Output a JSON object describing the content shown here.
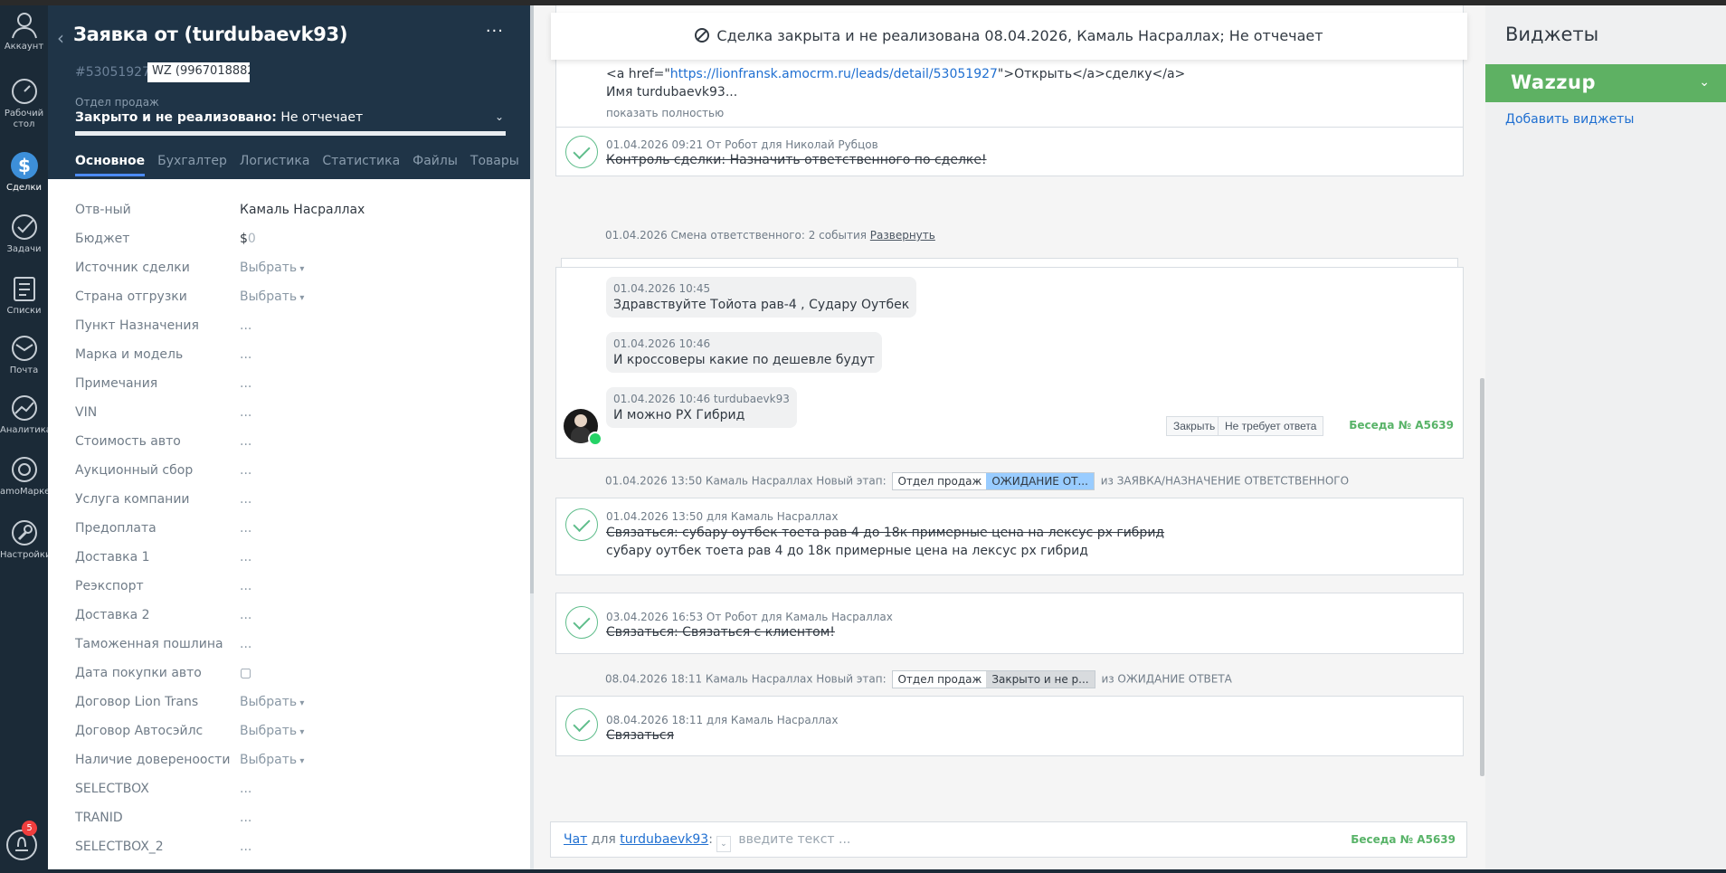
{
  "nav": {
    "items": [
      {
        "label": "Аккаунт",
        "icon": "user-icon"
      },
      {
        "label": "Рабочий стол",
        "icon": "dashboard-icon"
      },
      {
        "label": "Сделки",
        "icon": "dollar-icon"
      },
      {
        "label": "Задачи",
        "icon": "check-icon"
      },
      {
        "label": "Списки",
        "icon": "list-icon"
      },
      {
        "label": "Почта",
        "icon": "mail-icon"
      },
      {
        "label": "Аналитика",
        "icon": "analytics-icon"
      },
      {
        "label": "amoМаркет",
        "icon": "market-icon"
      },
      {
        "label": "Настройки",
        "icon": "wrench-icon"
      }
    ],
    "notifications_count": "5"
  },
  "card": {
    "title": "Заявка от (turdubaevk93)",
    "lead_id": "#53051927",
    "tag": "WZ (9967018882",
    "pipeline": "Отдел продаж",
    "status_bold": "Закрыто и не реализовано:",
    "status_reason": " Не отчечает",
    "tabs": [
      "Основное",
      "Бухгалтер",
      "Логистика",
      "Статистика",
      "Файлы",
      "Товары",
      "···"
    ],
    "fields": [
      {
        "label": "Отв-ный",
        "value": "Камаль Насраллах"
      },
      {
        "label": "Бюджет",
        "value": "$",
        "value2": "0"
      },
      {
        "label": "Источник сделки",
        "value": "Выбрать",
        "select": true
      },
      {
        "label": "Страна отгрузки",
        "value": "Выбрать",
        "select": true
      },
      {
        "label": "Пункт Назначения",
        "value": "..."
      },
      {
        "label": "Марка и модель",
        "value": "..."
      },
      {
        "label": "Примечания",
        "value": "..."
      },
      {
        "label": "VIN",
        "value": "..."
      },
      {
        "label": "Стоимость авто",
        "value": "..."
      },
      {
        "label": "Аукционный сбор",
        "value": "..."
      },
      {
        "label": "Услуга компании",
        "value": "..."
      },
      {
        "label": "Предоплата",
        "value": "..."
      },
      {
        "label": "Доставка 1",
        "value": "..."
      },
      {
        "label": "Реэкспорт",
        "value": "..."
      },
      {
        "label": "Доставка 2",
        "value": "..."
      },
      {
        "label": "Таможенная пошлина",
        "value": "..."
      },
      {
        "label": "Дата покупки авто",
        "value": "▢"
      },
      {
        "label": "Договор Lion Trans",
        "value": "Выбрать",
        "select": true
      },
      {
        "label": "Договор Автосэйлс",
        "value": "Выбрать",
        "select": true
      },
      {
        "label": "Наличие довереноости",
        "value": "Выбрать",
        "select": true
      },
      {
        "label": "SELECTBOX",
        "value": "..."
      },
      {
        "label": "TRANID",
        "value": "..."
      },
      {
        "label": "SELECTBOX_2",
        "value": "..."
      }
    ]
  },
  "feed": {
    "toast": "Сделка закрыта и не реализована 08.04.2026, Камаль Насраллах; Не отчечает",
    "note": {
      "link_prefix": "<a href=\"",
      "link_url": "https://lionfransk.amocrm.ru/leads/detail/53051927",
      "link_suffix": "\">Открыть</a>сделку</a>",
      "name": "Имя turdubaevk93...",
      "more": "показать полностью"
    },
    "task1": {
      "meta": "01.04.2026 09:21  От Робот для Николай Рубцов",
      "text": "Контроль сделки: Назначить ответственного по сделке!"
    },
    "resp_change": {
      "text": "01.04.2026 Смена ответственного: 2 события ",
      "link": "Развернуть"
    },
    "chat": {
      "messages": [
        {
          "time": "01.04.2026 10:45",
          "text": "Здравствуйте Тойота рав-4 , Судару Оутбек"
        },
        {
          "time": "01.04.2026 10:46",
          "text": "И кроссоверы какие по дешевле будут"
        },
        {
          "time": "01.04.2026 10:46 turdubaevk93",
          "text": "И можно РХ Гибрид"
        }
      ],
      "close_btn": "Закрыть",
      "noreply_btn": "Не требует ответа",
      "conversation": "Беседа № А5639"
    },
    "stage1": {
      "prefix": "01.04.2026 13:50 Камаль Насраллах Новый этап:",
      "pipe": "Отдел продаж",
      "stage": "ОЖИДАНИЕ ОТ...",
      "stage_color": "#99ccff",
      "suffix": "из ЗАЯВКА/НАЗНАЧЕНИЕ ОТВЕТСТВЕННОГО"
    },
    "task2": {
      "meta": "01.04.2026 13:50  для Камаль Насраллах",
      "text": "Связаться: субару оутбек тоета рав 4 до 18к примерные цена на лексус рх гибрид",
      "result": "субару оутбек тоета рав 4 до 18к примерные цена на лексус рх гибрид"
    },
    "task3": {
      "meta": "03.04.2026 16:53  От Робот для Камаль Насраллах",
      "text": "Связаться: Связаться с клиентом!"
    },
    "stage2": {
      "prefix": "08.04.2026 18:11 Камаль Насраллах Новый этап:",
      "pipe": "Отдел продаж",
      "stage": "Закрыто и не р...",
      "stage_color": "#d8dbde",
      "suffix": "из ОЖИДАНИЕ ОТВЕТА"
    },
    "task4": {
      "meta": "08.04.2026 18:11  для Камаль Насраллах",
      "text": "Связаться"
    },
    "composer": {
      "chat_label": "Чат",
      "for": " для ",
      "user": "turdubaevk93",
      "colon": ":",
      "placeholder": " введите текст ...",
      "conversation": "Беседа № А5639"
    }
  },
  "widgets": {
    "title": "Виджеты",
    "wazzup": "Wazzup",
    "add": "Добавить виджеты"
  }
}
